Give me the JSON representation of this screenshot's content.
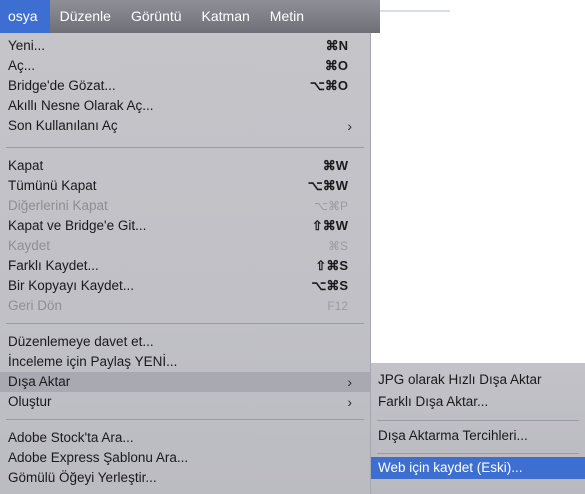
{
  "menubar": {
    "items": [
      "osya",
      "Düzenle",
      "Görüntü",
      "Katman",
      "Metin"
    ]
  },
  "menu": {
    "items": [
      {
        "label": "Yeni...",
        "shortcut": "⌘N"
      },
      {
        "label": "Aç...",
        "shortcut": "⌘O"
      },
      {
        "label": "Bridge'de Gözat...",
        "shortcut": "⌥⌘O"
      },
      {
        "label": "Akıllı Nesne Olarak Aç..."
      },
      {
        "label": "Son Kullanılanı Aç",
        "submenu": "›"
      },
      {
        "label": "Kapat",
        "shortcut": "⌘W"
      },
      {
        "label": "Tümünü Kapat",
        "shortcut": "⌥⌘W"
      },
      {
        "label": "Diğerlerini Kapat",
        "shortcut": "⌥⌘P"
      },
      {
        "label": "Kapat ve Bridge'e Git...",
        "shortcut": "⇧⌘W"
      },
      {
        "label": "Kaydet",
        "shortcut": "⌘S"
      },
      {
        "label": "Farklı Kaydet...",
        "shortcut": "⇧⌘S"
      },
      {
        "label": "Bir Kopyayı Kaydet...",
        "shortcut": "⌥⌘S"
      },
      {
        "label": "Geri Dön",
        "shortcut": "F12"
      },
      {
        "label": "Düzenlemeye davet et..."
      },
      {
        "label": "İnceleme için Paylaş YENİ..."
      },
      {
        "label": "Dışa Aktar",
        "submenu": "›"
      },
      {
        "label": "Oluştur",
        "submenu": "›"
      },
      {
        "label": "Adobe Stock'ta Ara..."
      },
      {
        "label": "Adobe Express Şablonu Ara..."
      },
      {
        "label": "Gömülü Öğeyi Yerleştir..."
      }
    ]
  },
  "submenu": {
    "items": [
      {
        "label": "JPG olarak Hızlı Dışa Aktar"
      },
      {
        "label": "Farklı Dışa Aktar..."
      },
      {
        "label": "Dışa Aktarma Tercihleri..."
      },
      {
        "label": "Web için kaydet (Eski)..."
      }
    ]
  }
}
